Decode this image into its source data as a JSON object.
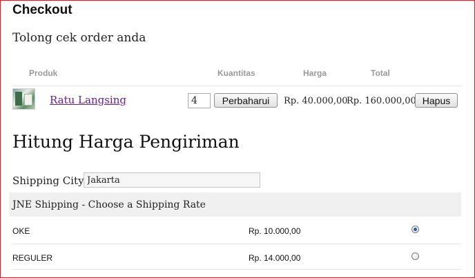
{
  "page": {
    "title": "Checkout",
    "subtitle": "Tolong cek order anda"
  },
  "cart": {
    "headers": {
      "product": "Produk",
      "quantity": "Kuantitas",
      "price": "Harga",
      "total": "Total"
    },
    "items": [
      {
        "name": "Ratu Langsing",
        "quantity": "4",
        "update_label": "Perbaharui",
        "price": "Rp. 40.000,00",
        "total": "Rp. 160.000,00",
        "remove_label": "Hapus"
      }
    ]
  },
  "shipping": {
    "title": "Hitung Harga Pengiriman",
    "city_label": "Shipping City:",
    "city_value": "Jakarta",
    "rate_header": "JNE Shipping - Choose a Shipping Rate",
    "rates": [
      {
        "name": "OKE",
        "price": "Rp. 10.000,00",
        "selected": true
      },
      {
        "name": "REGULER",
        "price": "Rp. 14.000,00",
        "selected": false
      }
    ]
  },
  "colors": {
    "border": "#e8191b",
    "link": "#6a1b9a",
    "header_text": "#999999"
  }
}
